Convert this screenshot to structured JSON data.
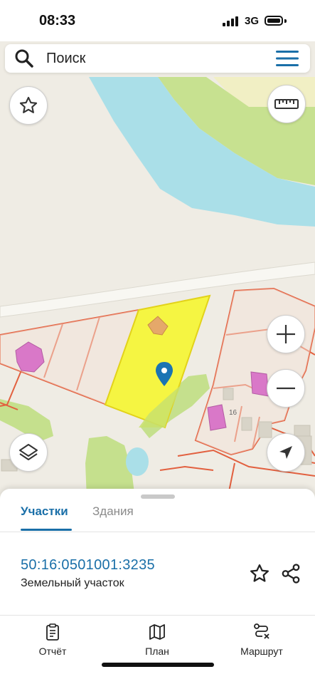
{
  "status_bar": {
    "time": "08:33",
    "network": "3G"
  },
  "search": {
    "placeholder": "Поиск",
    "search_icon": "search-icon",
    "menu_icon": "hamburger-menu-icon"
  },
  "map": {
    "house_number": "16",
    "controls": {
      "favorite_icon": "star-icon",
      "ruler_icon": "ruler-icon",
      "layers_icon": "layers-icon",
      "zoom_in_icon": "plus-icon",
      "zoom_out_icon": "minus-icon",
      "locate_icon": "location-arrow-icon"
    },
    "colors": {
      "water": "#aadfe8",
      "grass": "#c5e08d",
      "selected_parcel": "#f5f542",
      "parcel_border": "#e2603f",
      "building": "#d978c8",
      "marker": "#1a74b3"
    }
  },
  "sheet": {
    "tabs": [
      {
        "label": "Участки",
        "active": true
      },
      {
        "label": "Здания",
        "active": false
      }
    ],
    "parcel": {
      "number": "50:16:0501001:3235",
      "type": "Земельный участок"
    },
    "actions": {
      "favorite_icon": "star-outline-icon",
      "share_icon": "share-icon"
    },
    "accent_color": "#1a6fa8"
  },
  "bottom_nav": [
    {
      "label": "Отчёт",
      "icon": "report-icon"
    },
    {
      "label": "План",
      "icon": "map-icon"
    },
    {
      "label": "Маршрут",
      "icon": "route-icon"
    }
  ]
}
